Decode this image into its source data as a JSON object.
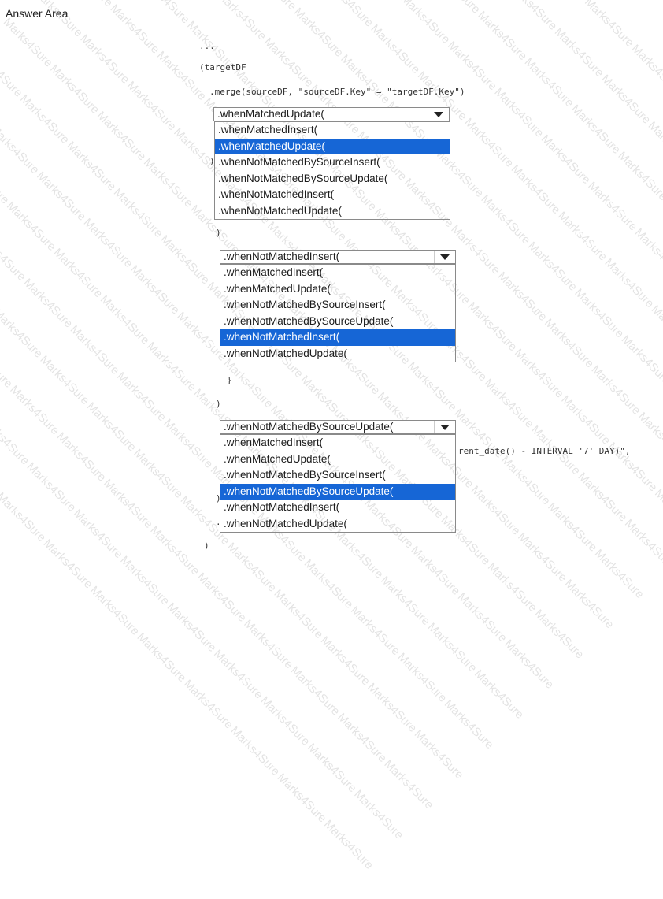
{
  "title": "Answer Area",
  "watermark_text": "Marks4Sure",
  "code": {
    "ellipsis": "...",
    "open": "(targetDF",
    "merge": ".merge(sourceDF, \"sourceDF.Key\" = \"targetDF.Key\")",
    "paren1": ")",
    "paren2": ")",
    "brace": "}",
    "paren3": ")",
    "partial_interval": "rent_date() - INTERVAL '7' DAY)\",",
    "paren4": ")",
    "dot": ".",
    "close": ")"
  },
  "options": [
    ".whenMatchedInsert(",
    ".whenMatchedUpdate(",
    ".whenNotMatchedBySourceInsert(",
    ".whenNotMatchedBySourceUpdate(",
    ".whenNotMatchedInsert(",
    ".whenNotMatchedUpdate("
  ],
  "dropdowns": [
    {
      "selected": ".whenMatchedUpdate(",
      "highlighted_index": 1
    },
    {
      "selected": ".whenNotMatchedInsert(",
      "highlighted_index": 4
    },
    {
      "selected": ".whenNotMatchedBySourceUpdate(",
      "highlighted_index": 3
    }
  ],
  "colors": {
    "highlight": "#1666d6",
    "border": "#8a8a8a"
  }
}
